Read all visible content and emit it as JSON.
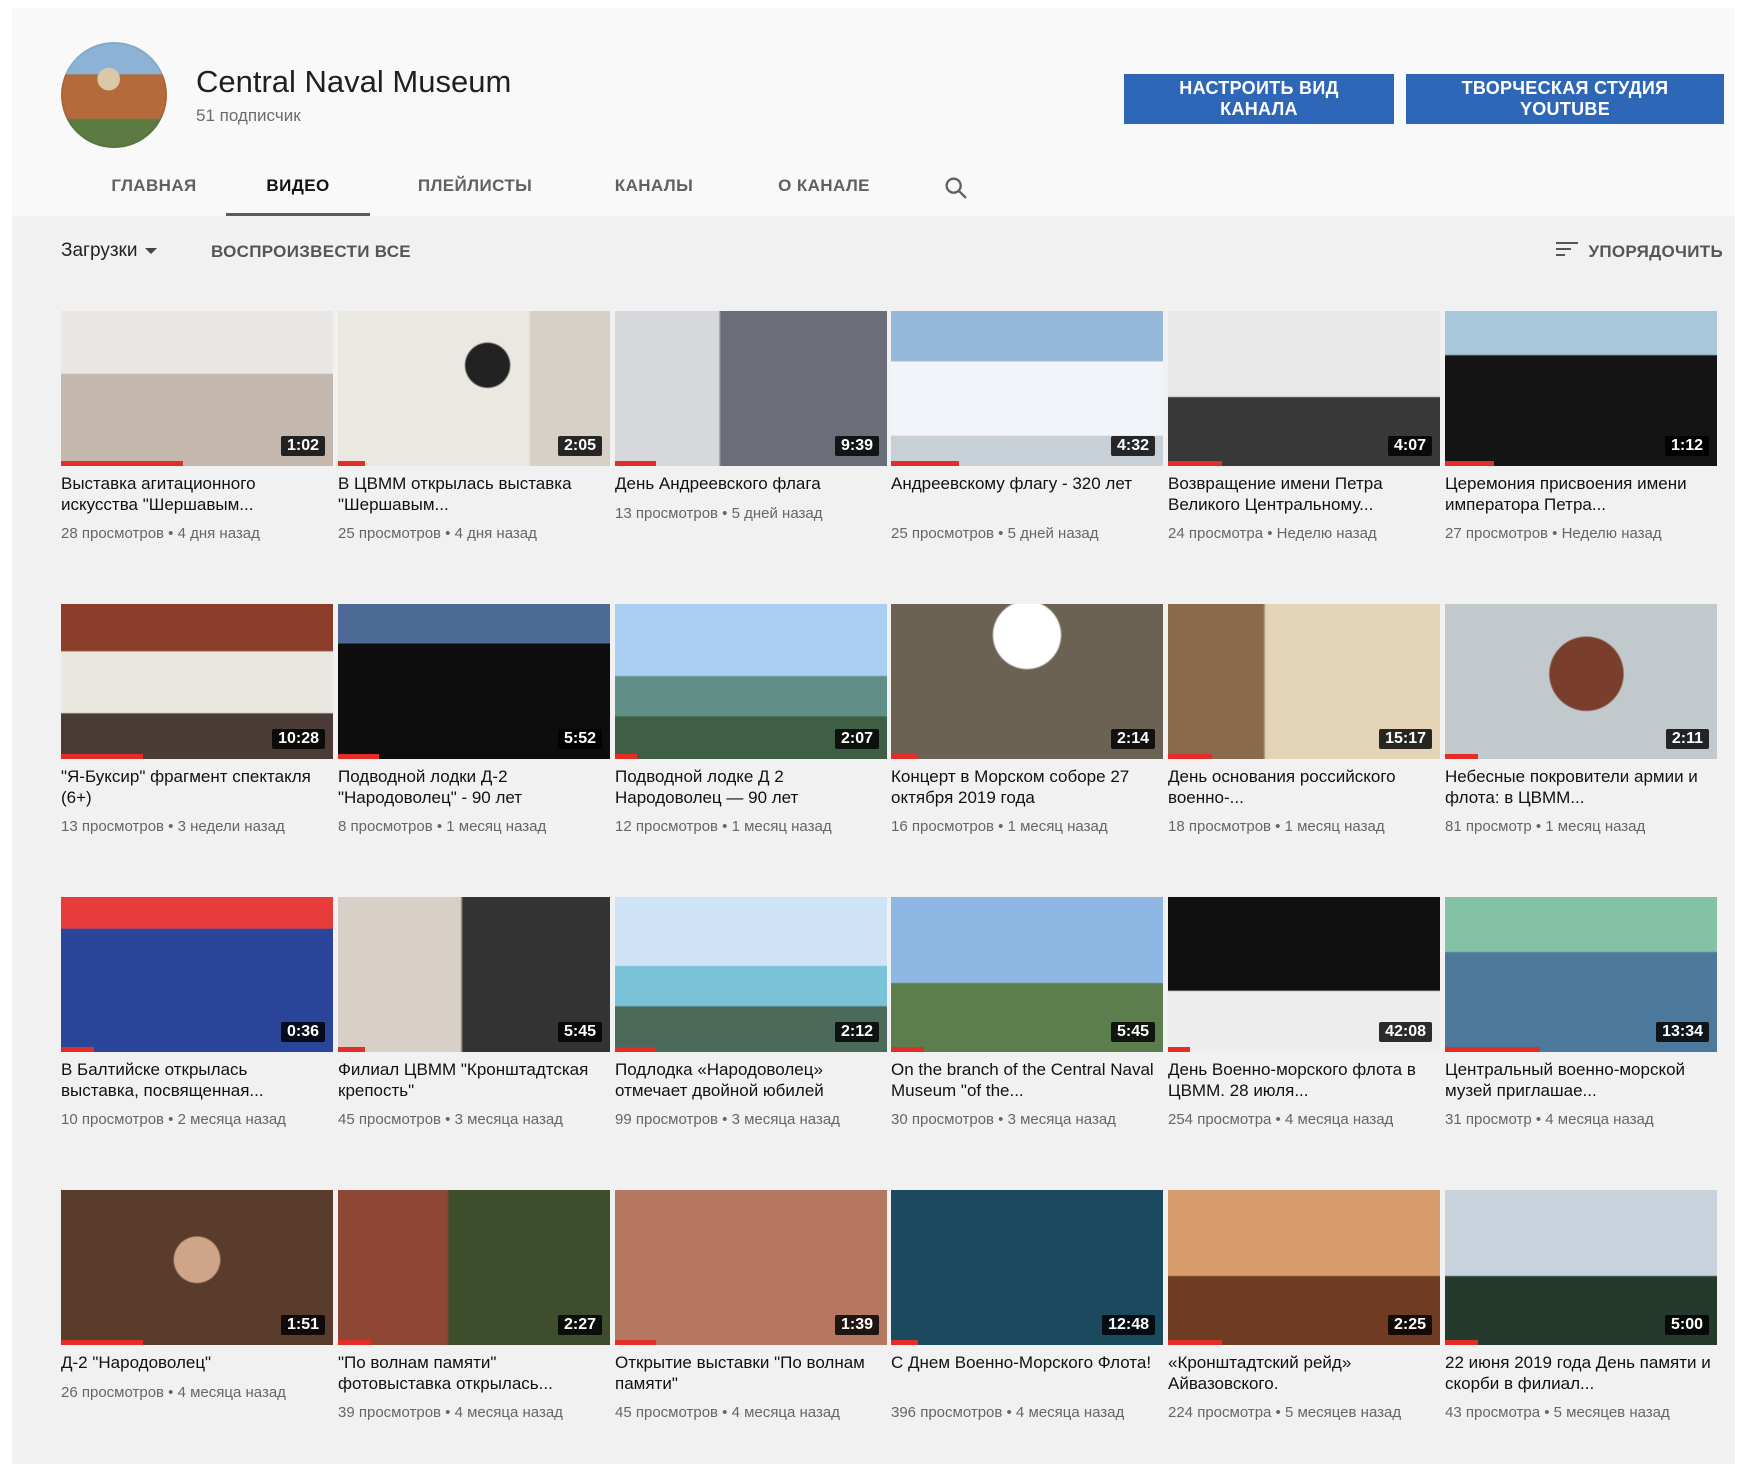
{
  "channel": {
    "name": "Central Naval Museum",
    "subscribers": "51 подписчик",
    "buttons": {
      "customize": "НАСТРОИТЬ ВИД КАНАЛА",
      "studio": "ТВОРЧЕСКАЯ СТУДИЯ YOUTUBE"
    }
  },
  "tabs": [
    {
      "label": "ГЛАВНАЯ"
    },
    {
      "label": "ВИДЕО"
    },
    {
      "label": "ПЛЕЙЛИСТЫ"
    },
    {
      "label": "КАНАЛЫ"
    },
    {
      "label": "О КАНАЛЕ"
    }
  ],
  "toolbar": {
    "dropdown": "Загрузки",
    "play_all": "ВОСПРОИЗВЕСТИ ВСЕ",
    "sort": "УПОРЯДОЧИТЬ"
  },
  "videos": [
    {
      "title": "Выставка агитационного искусства \"Шершавым...",
      "duration": "1:02",
      "meta": "28 просмотров • 4 дня назад",
      "progress": 0.45
    },
    {
      "title": "В ЦВММ открылась выставка \"Шершавым...",
      "duration": "2:05",
      "meta": "25 просмотров • 4 дня назад",
      "progress": 0.1
    },
    {
      "title": "День Андреевского флага",
      "duration": "9:39",
      "meta": "13 просмотров • 5 дней назад",
      "progress": 0.15
    },
    {
      "title": "Андреевскому флагу - 320 лет",
      "duration": "4:32",
      "meta": "25 просмотров • 5 дней назад",
      "progress": 0.25
    },
    {
      "title": "Возвращение имени Петра Великого Центральному...",
      "duration": "4:07",
      "meta": "24 просмотра • Неделю назад",
      "progress": 0.2
    },
    {
      "title": "Церемония присвоения имени императора Петра...",
      "duration": "1:12",
      "meta": "27 просмотров • Неделю назад",
      "progress": 0.18
    },
    {
      "title": "\"Я-Буксир\" фрагмент спектакля (6+)",
      "duration": "10:28",
      "meta": "13 просмотров • 3 недели назад",
      "progress": 0.3
    },
    {
      "title": "Подводной лодки Д-2 \"Народоволец\" - 90 лет",
      "duration": "5:52",
      "meta": "8 просмотров • 1 месяц назад",
      "progress": 0.15
    },
    {
      "title": "Подводной лодке Д 2 Народоволец — 90 лет",
      "duration": "2:07",
      "meta": "12 просмотров • 1 месяц назад",
      "progress": 0.08
    },
    {
      "title": "Концерт в Морском соборе 27 октября 2019 года",
      "duration": "2:14",
      "meta": "16 просмотров • 1 месяц назад",
      "progress": 0.1
    },
    {
      "title": "День основания российского военно-...",
      "duration": "15:17",
      "meta": "18 просмотров • 1 месяц назад",
      "progress": 0.16
    },
    {
      "title": "Небесные покровители армии и флота: в ЦВММ...",
      "duration": "2:11",
      "meta": "81 просмотр • 1 месяц назад",
      "progress": 0.12
    },
    {
      "title": "В Балтийске открылась выставка, посвященная...",
      "duration": "0:36",
      "meta": "10 просмотров • 2 месяца назад",
      "progress": 0.12
    },
    {
      "title": "Филиал ЦВММ \"Кронштадтская крепость\"",
      "duration": "5:45",
      "meta": "45 просмотров • 3 месяца назад",
      "progress": 0.1
    },
    {
      "title": "Подлодка «Народоволец» отмечает двойной юбилей",
      "duration": "2:12",
      "meta": "99 просмотров • 3 месяца назад",
      "progress": 0.15
    },
    {
      "title": "On the branch of the Central Naval Museum \"of the...",
      "duration": "5:45",
      "meta": "30 просмотров • 3 месяца назад",
      "progress": 0.12
    },
    {
      "title": "День Военно-морского флота в ЦВММ. 28 июля...",
      "duration": "42:08",
      "meta": "254 просмотра • 4 месяца назад",
      "progress": 0.08
    },
    {
      "title": "Центральный военно-морской музей приглашае...",
      "duration": "13:34",
      "meta": "31 просмотр • 4 месяца назад",
      "progress": 0.35
    },
    {
      "title": "Д-2 \"Народоволец\"",
      "duration": "1:51",
      "meta": "26 просмотров • 4 месяца назад",
      "progress": 0.3
    },
    {
      "title": "\"По волнам памяти\" фотовыставка открылась...",
      "duration": "2:27",
      "meta": "39 просмотров • 4 месяца назад",
      "progress": 0.12
    },
    {
      "title": "Открытие выставки \"По волнам памяти\"",
      "duration": "1:39",
      "meta": "45 просмотров • 4 месяца назад",
      "progress": 0.15
    },
    {
      "title": "С Днем Военно-Морского Флота!",
      "duration": "12:48",
      "meta": "396 просмотров • 4 месяца назад",
      "progress": 0.1
    },
    {
      "title": "«Кронштадтский рейд» Айвазовского.",
      "duration": "2:25",
      "meta": "224 просмотра • 5 месяцев назад",
      "progress": 0.2
    },
    {
      "title": "22 июня 2019 года День памяти и скорби в филиал...",
      "duration": "5:00",
      "meta": "43 просмотра • 5 месяцев назад",
      "progress": 0.12
    }
  ]
}
